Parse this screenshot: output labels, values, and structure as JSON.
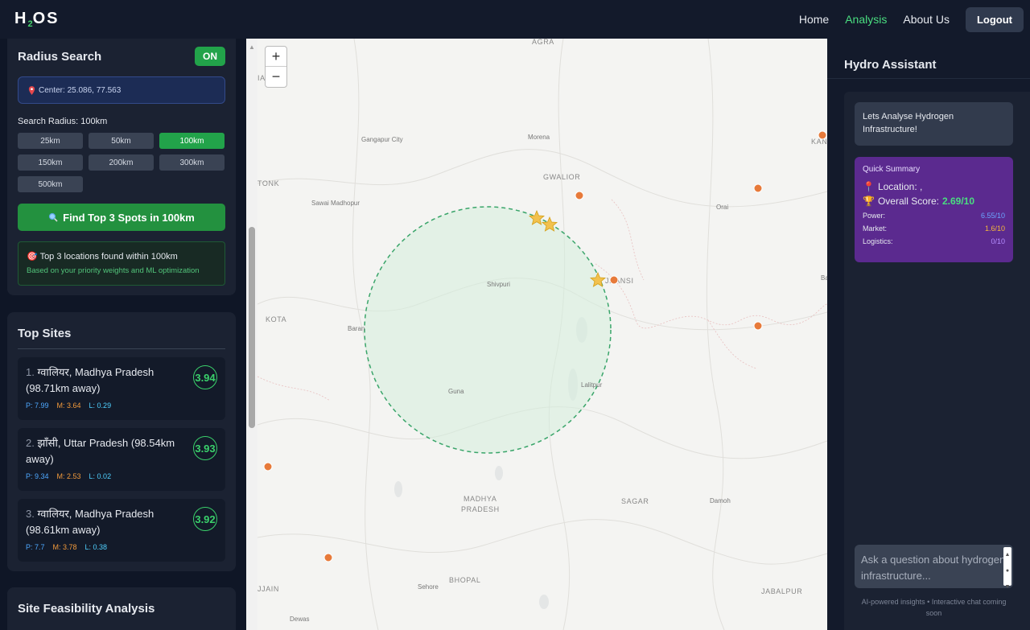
{
  "app": {
    "logo_main": "H",
    "logo_sub": "2",
    "logo_tail": "OS"
  },
  "nav": {
    "home": "Home",
    "analysis": "Analysis",
    "about": "About Us",
    "logout": "Logout"
  },
  "radius_search": {
    "title": "Radius Search",
    "toggle": "ON",
    "center_icon": "pin-icon",
    "center": "Center: 25.086, 77.563",
    "radius_label": "Search Radius: 100km",
    "options": [
      "25km",
      "50km",
      "100km",
      "150km",
      "200km",
      "300km",
      "500km"
    ],
    "selected": "100km",
    "find_button": "Find Top 3 Spots in 100km",
    "result_title": "Top 3 locations found within 100km",
    "result_sub": "Based on your priority weights and ML optimization"
  },
  "top_sites": {
    "title": "Top Sites",
    "items": [
      {
        "idx": "1.",
        "city": "ग्वालियर",
        "rest": ", Madhya Pradesh (98.71km away)",
        "p": "P: 7.99",
        "m": "M: 3.64",
        "l": "L: 0.29",
        "score": "3.94"
      },
      {
        "idx": "2.",
        "city": "झाँसी",
        "rest": ", Uttar Pradesh (98.54km away)",
        "p": "P: 9.34",
        "m": "M: 2.53",
        "l": "L: 0.02",
        "score": "3.93"
      },
      {
        "idx": "3.",
        "city": "ग्वालियर",
        "rest": ", Madhya Pradesh (98.61km away)",
        "p": "P: 7.7",
        "m": "M: 3.78",
        "l": "L: 0.38",
        "score": "3.92"
      }
    ]
  },
  "feasibility": {
    "title": "Site Feasibility Analysis"
  },
  "map": {
    "labels": [
      "AGRA",
      "Gangapur City",
      "Morena",
      "GWALIOR",
      "TONK",
      "Sawai Madhopur",
      "Orai",
      "Shivpuri",
      "KOTA",
      "Baran",
      "Guna",
      "Lalitpur",
      "MADHYA",
      "PRADESH",
      "SAGAR",
      "Damoh",
      "BHOPAL",
      "Sehore",
      "JABALPUR",
      "UJJAIN",
      "Dewas",
      "JHANSI",
      "KAN",
      "IA",
      "Ba"
    ],
    "zoom_in": "+",
    "zoom_out": "−"
  },
  "assistant": {
    "title": "Hydro Assistant",
    "greeting": "Lets Analyse Hydrogen Infrastructure!",
    "summary_title": "Quick Summary",
    "location_label": "Location: ,",
    "overall_label": "Overall Score:",
    "overall_value": "2.69/10",
    "power_label": "Power:",
    "power_value": "6.55/10",
    "market_label": "Market:",
    "market_value": "1.6/10",
    "logistics_label": "Logistics:",
    "logistics_value": "0/10",
    "input_placeholder": "Ask a question about hydrogen infrastructure...",
    "footer": "AI-powered insights • Interactive chat coming soon"
  },
  "colors": {
    "accent": "#4ade80",
    "on": "#22a34a",
    "summary_bg": "#5b2a8f",
    "panel": "#1b2232"
  }
}
